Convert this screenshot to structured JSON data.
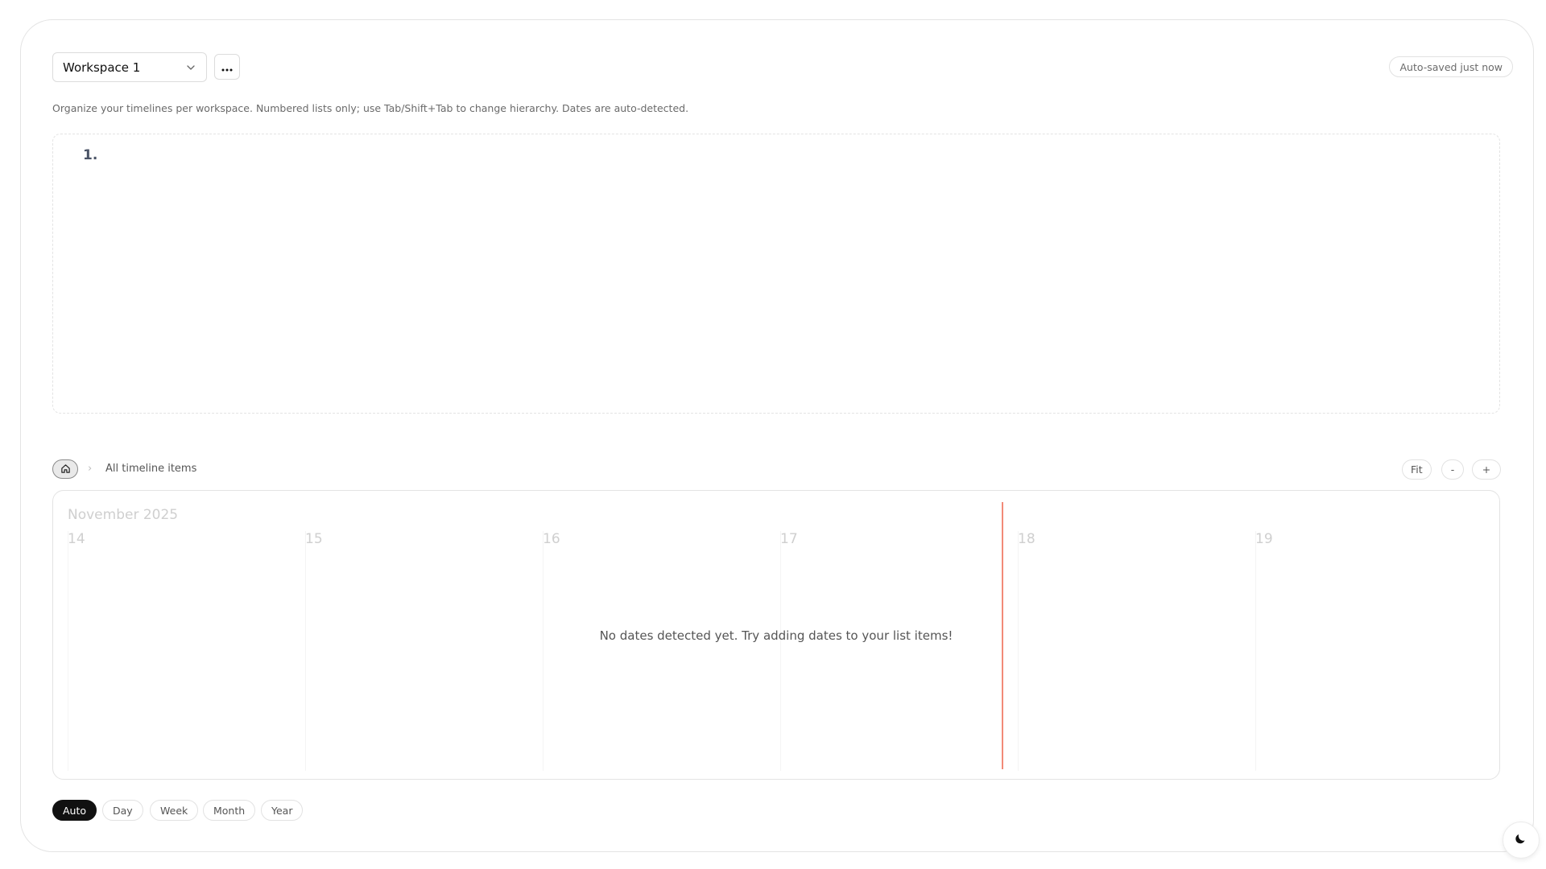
{
  "header": {
    "workspace_selected": "Workspace 1",
    "more_icon": "ellipsis-icon",
    "autosave_status": "Auto-saved just now"
  },
  "help_text": "Organize your timelines per workspace. Numbered lists only; use Tab/Shift+Tab to change hierarchy. Dates are auto-detected.",
  "editor": {
    "list_marker": "1."
  },
  "breadcrumb": {
    "home_icon": "home-icon",
    "separator": "›",
    "current": "All timeline items"
  },
  "zoom": {
    "fit_label": "Fit",
    "out_label": "-",
    "in_label": "+"
  },
  "timeline": {
    "month_label": "November 2025",
    "days": [
      "14",
      "15",
      "16",
      "17",
      "18",
      "19"
    ],
    "empty_message": "No dates detected yet. Try adding dates to your list items!",
    "today_line_color": "#f28a78"
  },
  "scales": [
    {
      "label": "Auto",
      "active": true
    },
    {
      "label": "Day",
      "active": false
    },
    {
      "label": "Week",
      "active": false
    },
    {
      "label": "Month",
      "active": false
    },
    {
      "label": "Year",
      "active": false
    }
  ],
  "theme_toggle_icon": "moon-icon"
}
